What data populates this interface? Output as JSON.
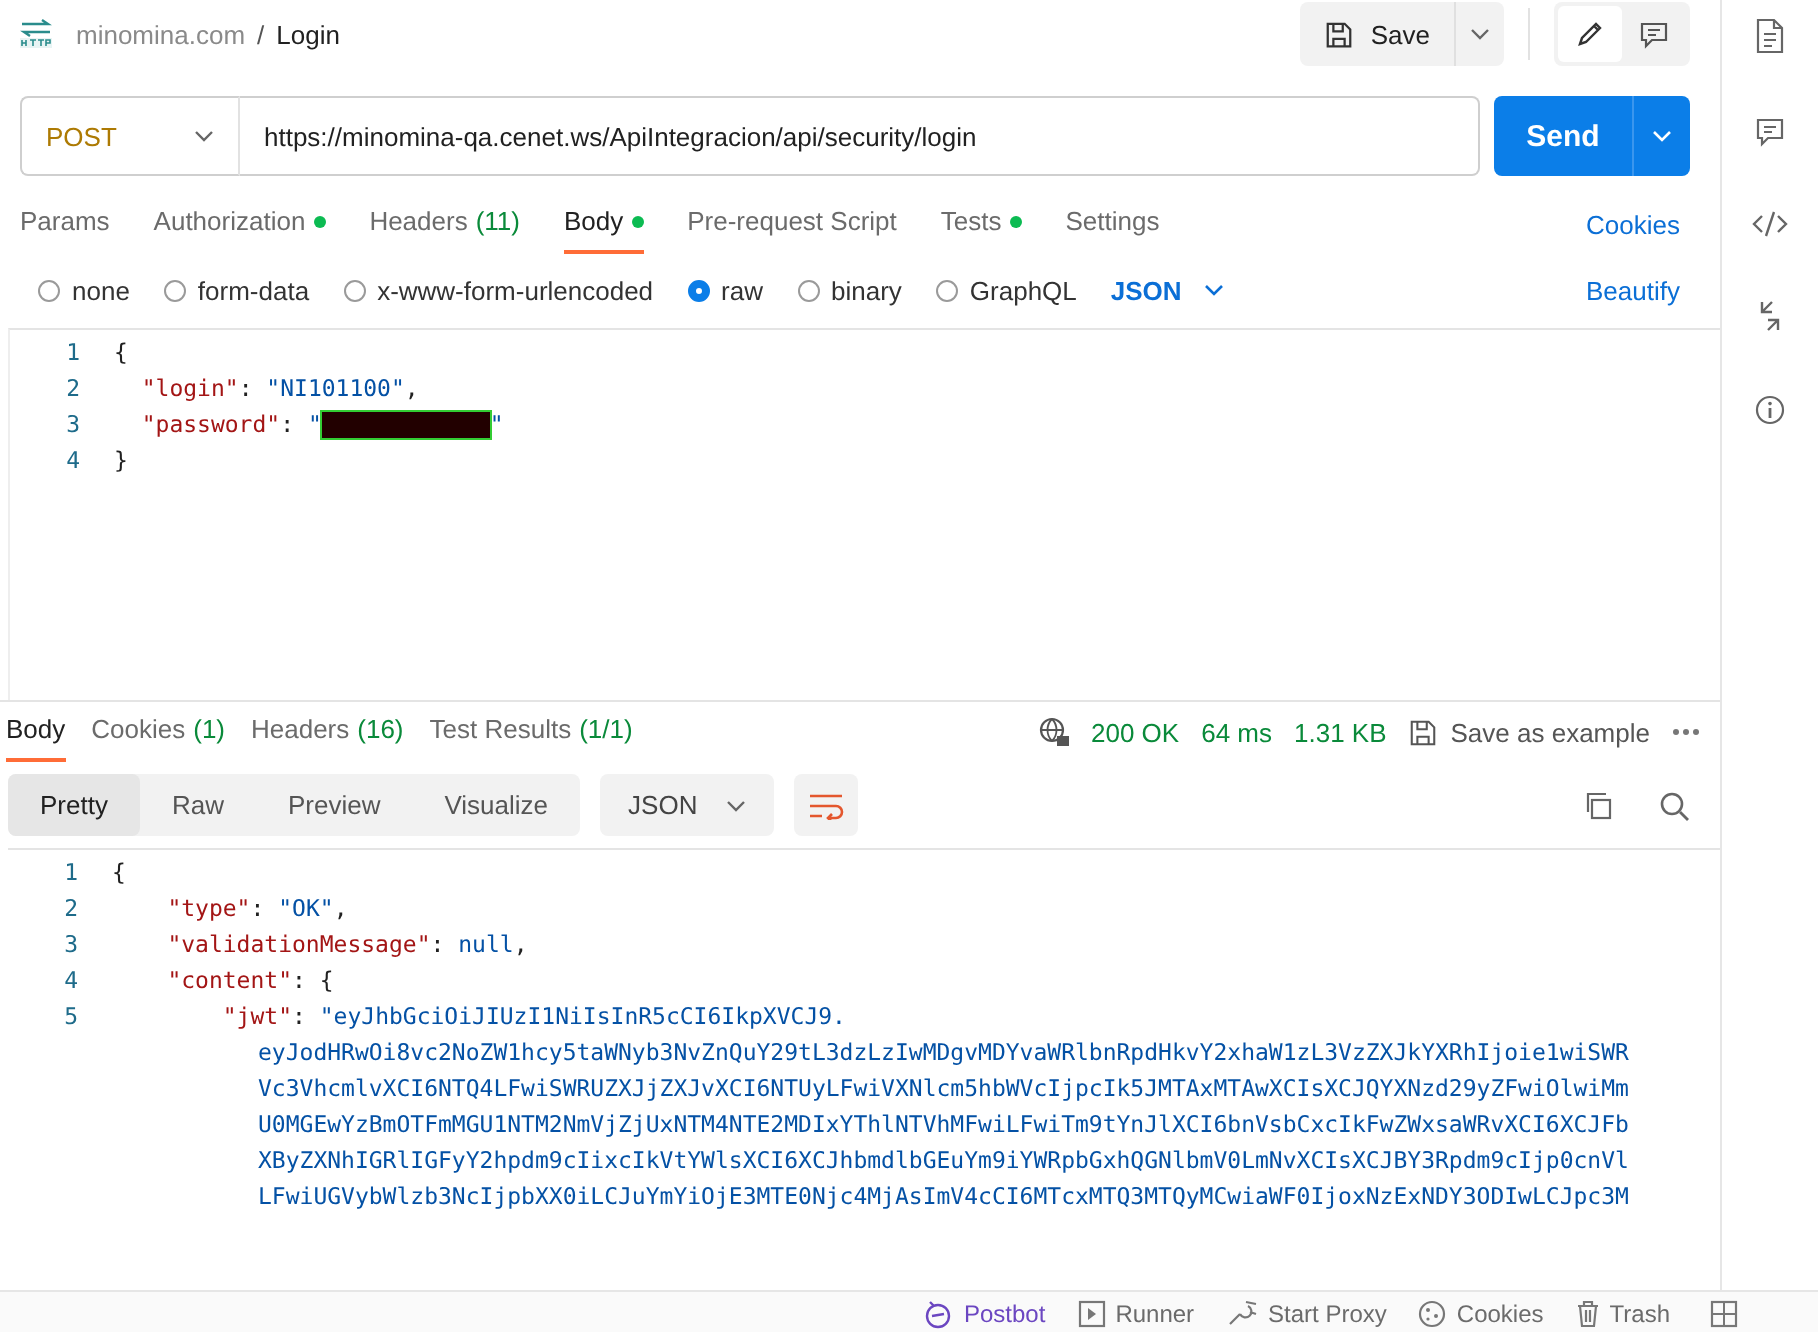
{
  "breadcrumb": {
    "parent": "minomina.com",
    "separator": "/",
    "title": "Login"
  },
  "save_button": "Save",
  "request": {
    "method": "POST",
    "url": "https://minomina-qa.cenet.ws/ApiIntegracion/api/security/login",
    "send_button": "Send"
  },
  "request_tabs": [
    {
      "label": "Params",
      "dot": false,
      "selected": false
    },
    {
      "label": "Authorization",
      "dot": true,
      "selected": false
    },
    {
      "label": "Headers",
      "count": "(11)",
      "dot": false,
      "selected": false
    },
    {
      "label": "Body",
      "dot": true,
      "selected": true
    },
    {
      "label": "Pre-request Script",
      "dot": false,
      "selected": false
    },
    {
      "label": "Tests",
      "dot": true,
      "selected": false
    },
    {
      "label": "Settings",
      "dot": false,
      "selected": false
    }
  ],
  "cookies_link": "Cookies",
  "body_types": [
    {
      "label": "none",
      "selected": false
    },
    {
      "label": "form-data",
      "selected": false
    },
    {
      "label": "x-www-form-urlencoded",
      "selected": false
    },
    {
      "label": "raw",
      "selected": true
    },
    {
      "label": "binary",
      "selected": false
    },
    {
      "label": "GraphQL",
      "selected": false
    }
  ],
  "body_format": "JSON",
  "beautify_link": "Beautify",
  "request_body": [
    {
      "number": "1",
      "tokens": [
        {
          "kind": "punct",
          "text": "{"
        }
      ]
    },
    {
      "number": "2",
      "tokens": [
        {
          "kind": "key",
          "text": "  \"login\""
        },
        {
          "kind": "punct",
          "text": ": "
        },
        {
          "kind": "string",
          "text": "\"NI101100\""
        },
        {
          "kind": "punct",
          "text": ","
        }
      ]
    },
    {
      "number": "3",
      "tokens": [
        {
          "kind": "key",
          "text": "  \"password\""
        },
        {
          "kind": "punct",
          "text": ": "
        },
        {
          "kind": "string",
          "text": "\""
        },
        {
          "kind": "redacted"
        },
        {
          "kind": "string",
          "text": "\""
        }
      ]
    },
    {
      "number": "4",
      "tokens": [
        {
          "kind": "punct",
          "text": "}"
        }
      ]
    }
  ],
  "response_tabs": [
    {
      "label": "Body",
      "selected": true
    },
    {
      "label": "Cookies",
      "count": "(1)",
      "selected": false
    },
    {
      "label": "Headers",
      "count": "(16)",
      "selected": false
    },
    {
      "label": "Test Results",
      "count": "(1/1)",
      "selected": false
    }
  ],
  "response_status": {
    "code": "200 OK",
    "time": "64 ms",
    "size": "1.31 KB",
    "save_example": "Save as example"
  },
  "view_modes": [
    {
      "label": "Pretty",
      "selected": true
    },
    {
      "label": "Raw",
      "selected": false
    },
    {
      "label": "Preview",
      "selected": false
    },
    {
      "label": "Visualize",
      "selected": false
    }
  ],
  "response_format": "JSON",
  "response_body": [
    {
      "number": "1",
      "tokens": [
        {
          "kind": "punct",
          "text": "{"
        }
      ]
    },
    {
      "number": "2",
      "tokens": [
        {
          "kind": "key",
          "text": "    \"type\""
        },
        {
          "kind": "punct",
          "text": ": "
        },
        {
          "kind": "string",
          "text": "\"OK\""
        },
        {
          "kind": "punct",
          "text": ","
        }
      ]
    },
    {
      "number": "3",
      "tokens": [
        {
          "kind": "key",
          "text": "    \"validationMessage\""
        },
        {
          "kind": "punct",
          "text": ": "
        },
        {
          "kind": "literal",
          "text": "null"
        },
        {
          "kind": "punct",
          "text": ","
        }
      ]
    },
    {
      "number": "4",
      "tokens": [
        {
          "kind": "key",
          "text": "    \"content\""
        },
        {
          "kind": "punct",
          "text": ": {"
        }
      ]
    },
    {
      "number": "5",
      "tokens": [
        {
          "kind": "key",
          "text": "        \"jwt\""
        },
        {
          "kind": "punct",
          "text": ": "
        },
        {
          "kind": "string",
          "text": "\"eyJhbGciOiJIUzI1NiIsInR5cCI6IkpXVCJ9."
        }
      ],
      "wrapped": [
        "eyJodHRwOi8vc2NoZW1hcy5taWNyb3NvZnQuY29tL3dzLzIwMDgvMDYvaWRlbnRpdHkvY2xhaW1zL3VzZXJkYXRhIjoie1wiSWR",
        "Vc3VhcmlvXCI6NTQ4LFwiSWRUZXJjZXJvXCI6NTUyLFwiVXNlcm5hbWVcIjpcIk5JMTAxMTAwXCIsXCJQYXNzd29yZFwiOlwiMm",
        "U0MGEwYzBmOTFmMGU1NTM2NmVjZjUxNTM4NTE2MDIxYThlNTVhMFwiLFwiTm9tYnJlXCI6bnVsbCxcIkFwZWxsaWRvXCI6XCJFb",
        "XByZXNhIGRlIGFyY2hpdm9cIixcIkVtYWlsXCI6XCJhbmdlbGEuYm9iYWRpbGxhQGNlbmV0LmNvXCIsXCJBY3Rpdm9cIjp0cnVl",
        "LFwiUGVybWlzb3NcIjpbXX0iLCJuYmYiOjE3MTE0Njc4MjAsImV4cCI6MTcxMTQ3MTQyMCwiaWF0IjoxNzExNDY3ODIwLCJpc3M"
      ]
    }
  ],
  "status_bar": [
    {
      "kind": "postbot",
      "label": "Postbot"
    },
    {
      "kind": "runner",
      "label": "Runner"
    },
    {
      "kind": "proxy",
      "label": "Start Proxy"
    },
    {
      "kind": "cookies",
      "label": "Cookies"
    },
    {
      "kind": "trash",
      "label": "Trash"
    }
  ]
}
